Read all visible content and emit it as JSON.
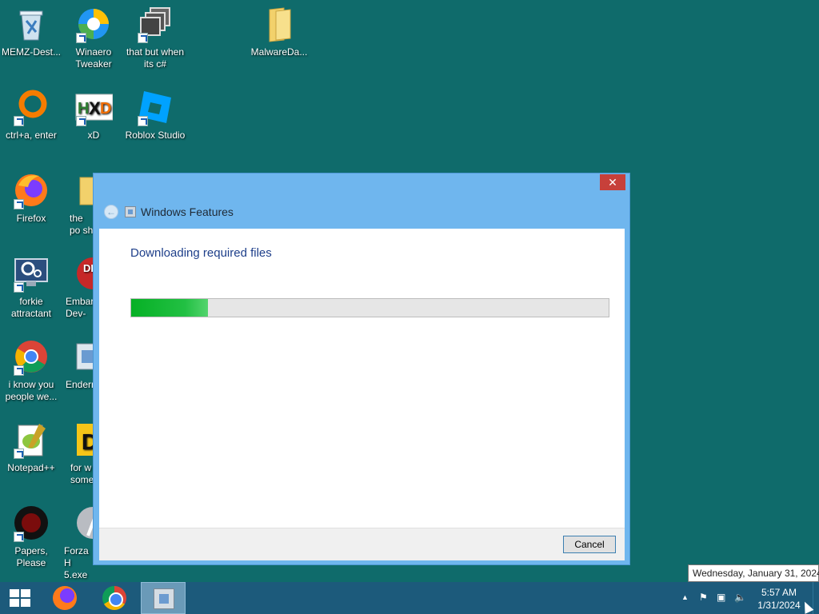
{
  "desktop": {
    "icons": [
      {
        "label": "MEMZ-Dest...",
        "icon": "recycle-bin-icon"
      },
      {
        "label": "Winaero Tweaker",
        "icon": "winaero-icon"
      },
      {
        "label": "that but when its c#",
        "icon": "stacked-windows-icon"
      },
      {
        "label": "MalwareDa...",
        "icon": "folder-icon"
      },
      {
        "label": "ctrl+a, enter",
        "icon": "orange-ring-icon"
      },
      {
        "label": "xD",
        "icon": "hxd-icon"
      },
      {
        "label": "Roblox Studio",
        "icon": "roblox-studio-icon"
      },
      {
        "label": "Firefox",
        "icon": "firefox-icon"
      },
      {
        "label": "the po sh",
        "icon": "folder-icon"
      },
      {
        "label": "forkie attractant",
        "icon": "monitor-gear-icon"
      },
      {
        "label": "Embar Dev-",
        "icon": "red-badge-icon"
      },
      {
        "label": "i know you people we...",
        "icon": "chrome-icon"
      },
      {
        "label": "Enderm",
        "icon": "window-icon"
      },
      {
        "label": "Notepad++",
        "icon": "notepadpp-icon"
      },
      {
        "label": "for w some",
        "icon": "yellow-app-icon"
      },
      {
        "label": "Papers, Please",
        "icon": "papers-please-icon"
      },
      {
        "label": "Forza H 5.exe",
        "icon": "forza-icon"
      }
    ]
  },
  "dialog": {
    "title": "Windows Features",
    "close_label": "✕",
    "heading": "Downloading required files",
    "progress_fraction": 0.16,
    "cancel_label": "Cancel"
  },
  "taskbar": {
    "clock_time": "5:57 AM",
    "clock_date": "1/31/2024",
    "tooltip": "Wednesday, January 31, 2024"
  },
  "colors": {
    "desktop_bg": "#0f6b6b",
    "taskbar_bg": "#1c5a7b",
    "dialog_frame": "#6fb6ee",
    "close_red": "#c7403a",
    "progress_green": "#06b025"
  }
}
